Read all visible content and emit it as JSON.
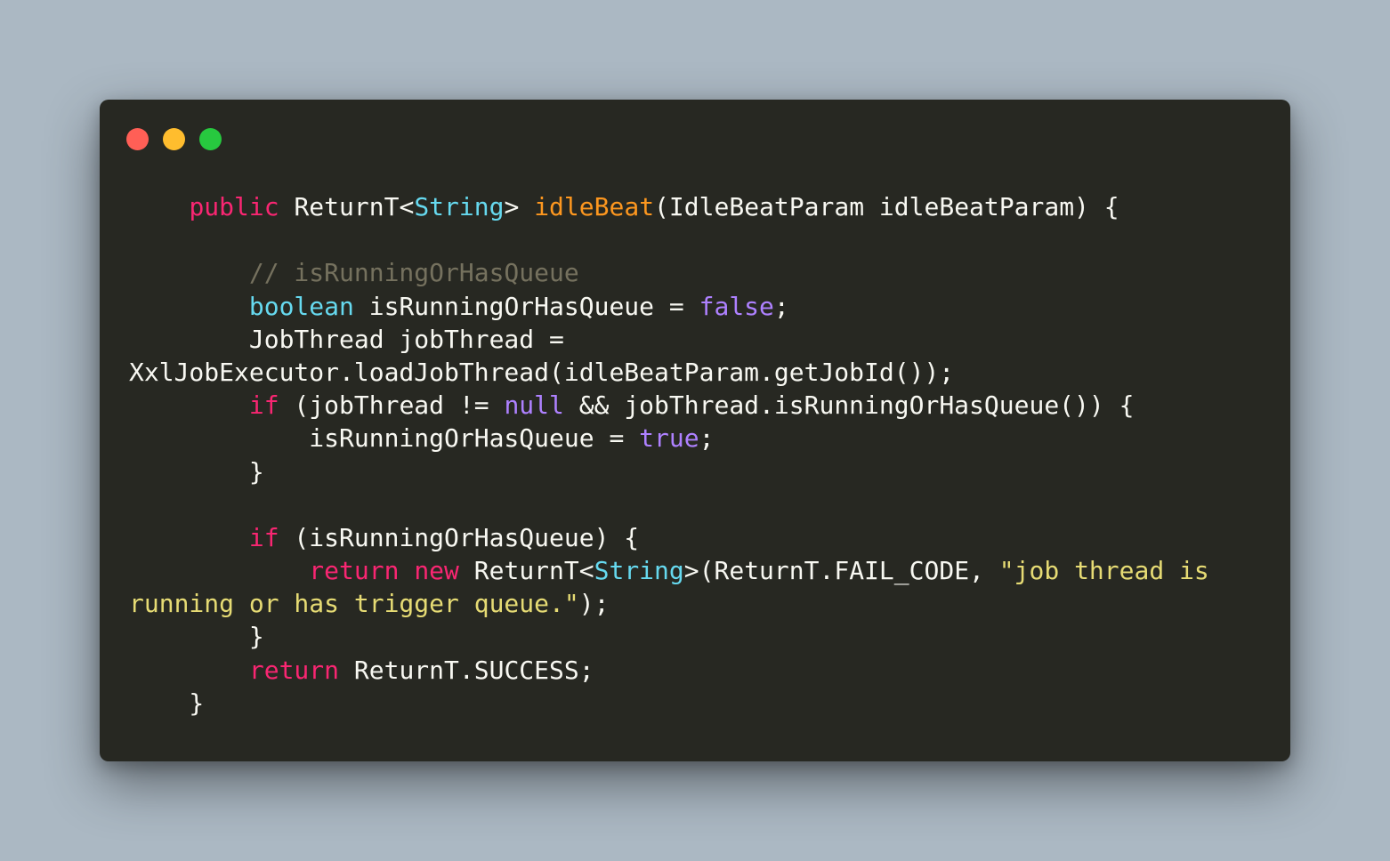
{
  "window": {
    "buttons": [
      "close",
      "minimize",
      "maximize"
    ],
    "colors": {
      "background": "#272822",
      "page_background": "#abb8c3",
      "close": "#ff5f56",
      "minimize": "#ffbd2e",
      "maximize": "#27c93f"
    }
  },
  "code": {
    "language": "java",
    "theme_colors": {
      "keyword": "#f92672",
      "type": "#66d9ef",
      "function": "#fd971f",
      "string": "#e6db74",
      "constant": "#ae81ff",
      "comment": "#75715e",
      "text": "#f8f8f2"
    },
    "lines": [
      [
        {
          "t": "    ",
          "k": "plain"
        },
        {
          "t": "public",
          "k": "kw"
        },
        {
          "t": " ReturnT<",
          "k": "plain"
        },
        {
          "t": "String",
          "k": "type"
        },
        {
          "t": "> ",
          "k": "plain"
        },
        {
          "t": "idleBeat",
          "k": "fn"
        },
        {
          "t": "(IdleBeatParam idleBeatParam) {",
          "k": "plain"
        }
      ],
      [],
      [
        {
          "t": "        ",
          "k": "plain"
        },
        {
          "t": "// isRunningOrHasQueue",
          "k": "comment"
        }
      ],
      [
        {
          "t": "        ",
          "k": "plain"
        },
        {
          "t": "boolean",
          "k": "type"
        },
        {
          "t": " isRunningOrHasQueue = ",
          "k": "plain"
        },
        {
          "t": "false",
          "k": "const"
        },
        {
          "t": ";",
          "k": "plain"
        }
      ],
      [
        {
          "t": "        JobThread jobThread =",
          "k": "plain"
        }
      ],
      [
        {
          "t": "XxlJobExecutor.loadJobThread(idleBeatParam.getJobId());",
          "k": "plain"
        }
      ],
      [
        {
          "t": "        ",
          "k": "plain"
        },
        {
          "t": "if",
          "k": "kw"
        },
        {
          "t": " (jobThread != ",
          "k": "plain"
        },
        {
          "t": "null",
          "k": "const"
        },
        {
          "t": " && jobThread.isRunningOrHasQueue()) {",
          "k": "plain"
        }
      ],
      [
        {
          "t": "            isRunningOrHasQueue = ",
          "k": "plain"
        },
        {
          "t": "true",
          "k": "const"
        },
        {
          "t": ";",
          "k": "plain"
        }
      ],
      [
        {
          "t": "        }",
          "k": "plain"
        }
      ],
      [],
      [
        {
          "t": "        ",
          "k": "plain"
        },
        {
          "t": "if",
          "k": "kw"
        },
        {
          "t": " (isRunningOrHasQueue) {",
          "k": "plain"
        }
      ],
      [
        {
          "t": "            ",
          "k": "plain"
        },
        {
          "t": "return",
          "k": "kw"
        },
        {
          "t": " ",
          "k": "plain"
        },
        {
          "t": "new",
          "k": "kw"
        },
        {
          "t": " ReturnT<",
          "k": "plain"
        },
        {
          "t": "String",
          "k": "type"
        },
        {
          "t": ">(ReturnT.FAIL_CODE, ",
          "k": "plain"
        },
        {
          "t": "\"job thread is",
          "k": "str"
        }
      ],
      [
        {
          "t": "running or has trigger queue.\"",
          "k": "str"
        },
        {
          "t": ");",
          "k": "plain"
        }
      ],
      [
        {
          "t": "        }",
          "k": "plain"
        }
      ],
      [
        {
          "t": "        ",
          "k": "plain"
        },
        {
          "t": "return",
          "k": "kw"
        },
        {
          "t": " ReturnT.SUCCESS;",
          "k": "plain"
        }
      ],
      [
        {
          "t": "    }",
          "k": "plain"
        }
      ]
    ]
  }
}
